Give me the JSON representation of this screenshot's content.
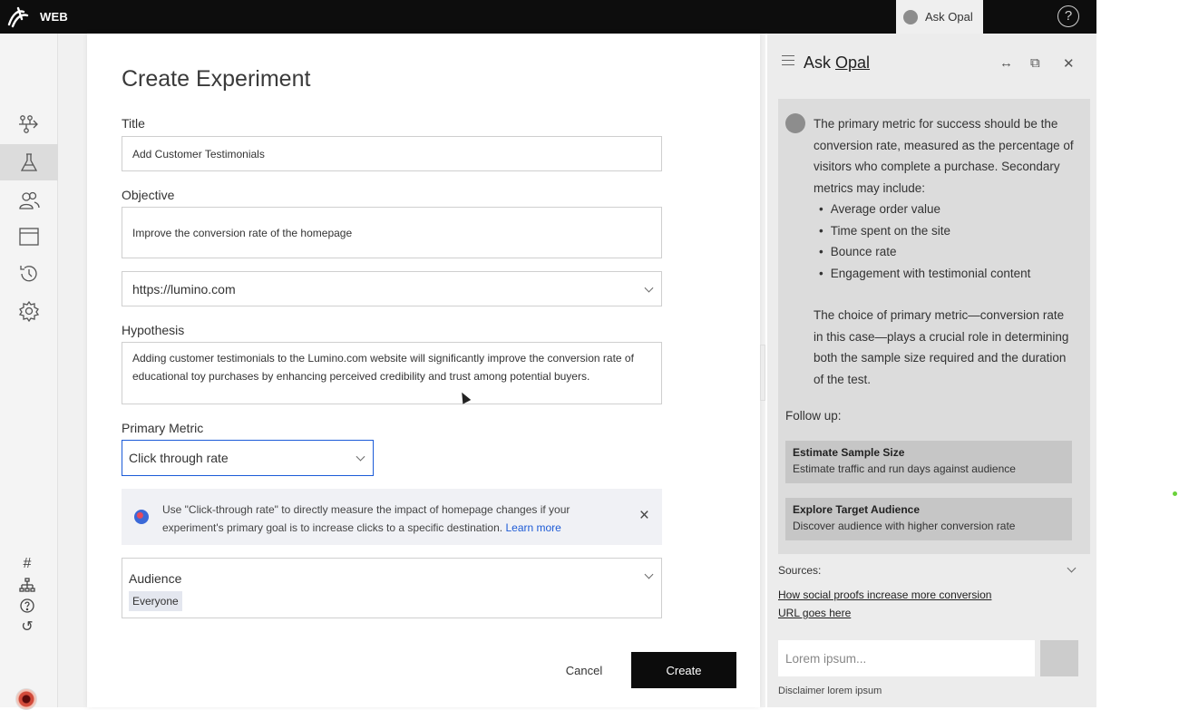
{
  "topbar": {
    "brand": "WEB",
    "ask_opal_tab": "Ask Opal",
    "help_icon": "help-circle-icon"
  },
  "sidebar": {
    "items": [
      {
        "icon": "flow-icon"
      },
      {
        "icon": "flask-icon",
        "active": true
      },
      {
        "icon": "users-icon"
      },
      {
        "icon": "window-icon"
      },
      {
        "icon": "history-icon"
      },
      {
        "icon": "gear-icon"
      }
    ],
    "bottom": [
      {
        "icon": "hash-icon",
        "glyph": "#"
      },
      {
        "icon": "hierarchy-icon"
      },
      {
        "icon": "help-icon",
        "glyph": "?"
      },
      {
        "icon": "undo-icon",
        "glyph": "↺"
      }
    ]
  },
  "form": {
    "page_title": "Create Experiment",
    "title_label": "Title",
    "title_value": "Add Customer Testimonials",
    "objective_label": "Objective",
    "objective_value": "Improve the conversion rate of the homepage",
    "url_value": "https://lumino.com",
    "hypothesis_label": "Hypothesis",
    "hypothesis_value": "Adding customer testimonials to the Lumino.com website will significantly improve the conversion rate of educational toy purchases by enhancing perceived credibility and trust among potential buyers.",
    "metric_label": "Primary Metric",
    "metric_value": "Click through rate",
    "banner_text": "Use \"Click-through rate\" to directly measure the impact of homepage changes if your experiment's primary goal is to increase clicks to a specific destination.",
    "banner_link": "Learn more",
    "audience_label": "Audience",
    "audience_chip": "Everyone",
    "cancel_label": "Cancel",
    "create_label": "Create"
  },
  "opal": {
    "title_prefix": "Ask ",
    "title_name": "Opal",
    "message_intro": "The primary metric for success should be the conversion rate, measured as the percentage of visitors who complete a purchase. Secondary metrics may include:",
    "bullets": [
      "Average order value",
      "Time spent on the site",
      "Bounce rate",
      "Engagement with testimonial content"
    ],
    "message_outro": "The choice of primary metric—conversion rate in this case—plays a crucial role in determining both the sample size required and the duration of the test.",
    "follow_up_label": "Follow up:",
    "suggestions": [
      {
        "title": "Estimate Sample Size",
        "desc": "Estimate traffic and run days against audience"
      },
      {
        "title": "Explore Target Audience",
        "desc": "Discover audience with higher conversion rate"
      }
    ],
    "sources_label": "Sources:",
    "sources": [
      "How social proofs increase more conversion",
      "URL goes here"
    ],
    "input_placeholder": "Lorem ipsum...",
    "disclaimer": "Disclaimer lorem ipsum"
  }
}
